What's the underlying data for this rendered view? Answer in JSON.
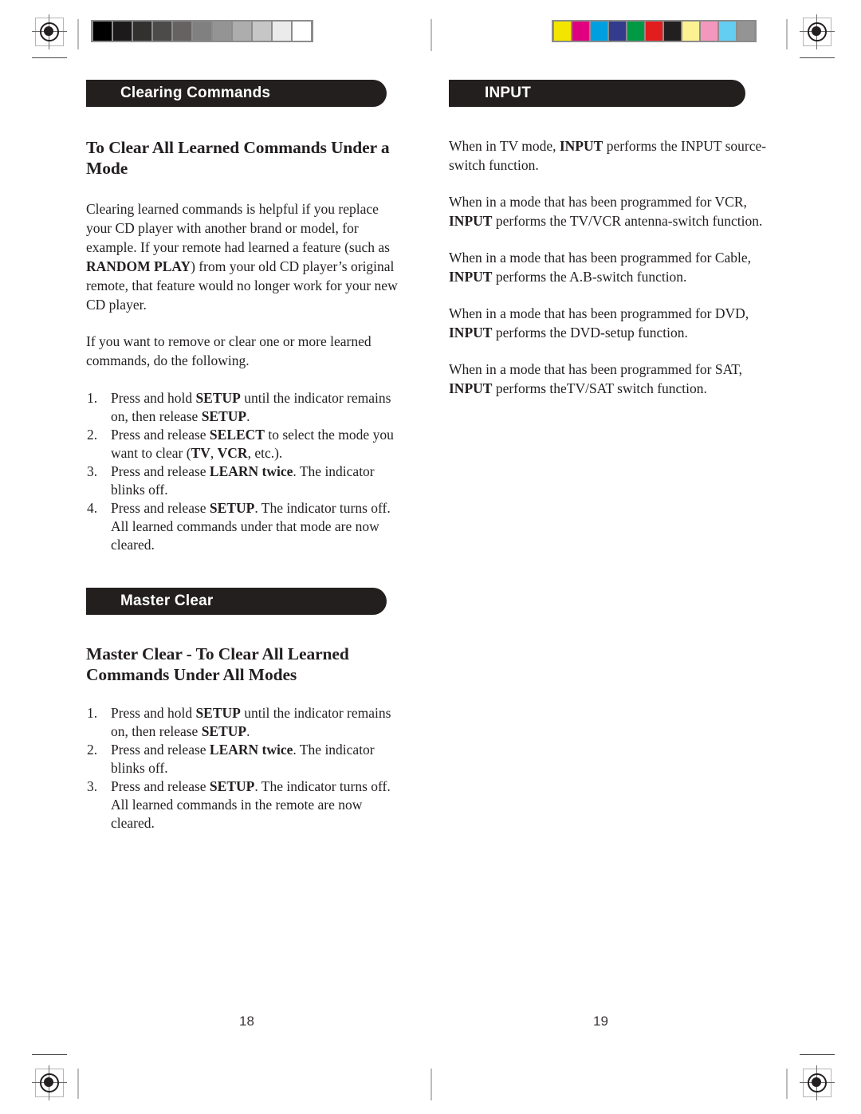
{
  "spread": {
    "left_page": {
      "folio": "18",
      "banner": "Clearing Commands",
      "section_heading": "To Clear All Learned Commands Under a Mode",
      "paragraphs": [
        "Clearing learned commands is helpful if you replace your CD player with another brand or model, for example. If your remote had learned a feature (such as RANDOM PLAY) from your old CD player's original remote, that feature would no longer work for your new CD player.",
        "If you want to remove or clear one or more learned commands, do the following."
      ],
      "steps": [
        "Press and hold SETUP until the indicator remains on, then release SETUP.",
        "Press and release SELECT to select the mode you want to clear (TV, VCR, etc.).",
        "Press and release LEARN twice. The indicator blinks off.",
        "Press and release SETUP. The indicator turns off. All learned commands under that mode are now cleared."
      ],
      "banner2": "Master Clear",
      "section_heading2": "Master Clear - To Clear All Learned Commands Under All Modes",
      "steps2": [
        "Press and hold SETUP until the indicator remains on, then release SETUP.",
        "Press and release LEARN twice. The indicator blinks off.",
        "Press and release SETUP. The indicator turns off. All learned commands in the remote are now cleared."
      ]
    },
    "right_page": {
      "folio": "19",
      "banner": "INPUT",
      "paragraphs": [
        "When in TV mode, INPUT performs the INPUT source-switch function.",
        "When in a mode that has been programmed for VCR, INPUT performs the TV/VCR antenna-switch function.",
        "When in a mode that has been programmed for Cable, INPUT performs the A.B-switch function.",
        "When in a mode that has been programmed for DVD, INPUT performs the DVD-setup function.",
        "When in a mode that has been programmed for SAT, INPUT performs the TV/SAT switch function."
      ]
    }
  },
  "calibration": {
    "grayscale_patches": [
      "#000000",
      "#1c1a1a",
      "#333030",
      "#4d4a4a",
      "#666262",
      "#808080",
      "#949494",
      "#adadad",
      "#c6c6c6",
      "#ebebeb",
      "#ffffff"
    ],
    "color_patches": [
      "#f2e500",
      "#e0007f",
      "#00a0e0",
      "#333c8c",
      "#009944",
      "#e21d1d",
      "#231f20",
      "#fcf293",
      "#f497bf",
      "#64cdf2",
      "#949494"
    ],
    "frame_color": "#8c8c8c"
  }
}
